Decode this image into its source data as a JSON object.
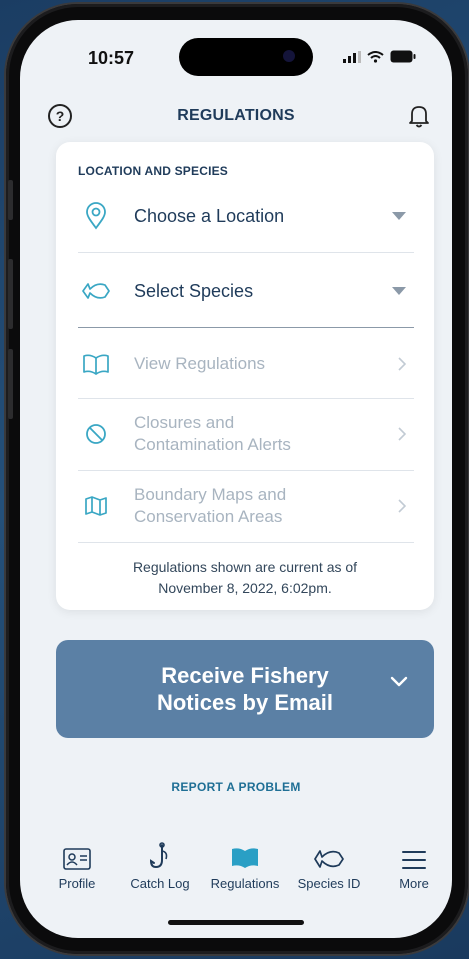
{
  "status_bar": {
    "time": "10:57"
  },
  "header": {
    "help_label": "?",
    "title": "REGULATIONS"
  },
  "card": {
    "section_label": "LOCATION AND SPECIES",
    "location_label": "Choose a Location",
    "species_label": "Select Species",
    "view_regulations_label": "View Regulations",
    "closures_line1": "Closures and",
    "closures_line2": "Contamination Alerts",
    "boundary_line1": "Boundary Maps and",
    "boundary_line2": "Conservation Areas",
    "footnote_line1": "Regulations shown are current as of",
    "footnote_line2": "November 8, 2022, 6:02pm."
  },
  "email_button": {
    "line1": "Receive Fishery",
    "line2": "Notices by Email"
  },
  "report_link": "REPORT A PROBLEM",
  "tabs": [
    {
      "label": "Profile",
      "icon": "profile-card-icon"
    },
    {
      "label": "Catch Log",
      "icon": "fishing-hook-icon"
    },
    {
      "label": "Regulations",
      "icon": "book-icon"
    },
    {
      "label": "Species ID",
      "icon": "fish-icon"
    },
    {
      "label": "More",
      "icon": "menu-icon"
    }
  ],
  "colors": {
    "accent": "#3aa7c4",
    "navy": "#1f3b5a",
    "email_button": "#5b80a5",
    "active_tab": "#2a9fc5"
  }
}
